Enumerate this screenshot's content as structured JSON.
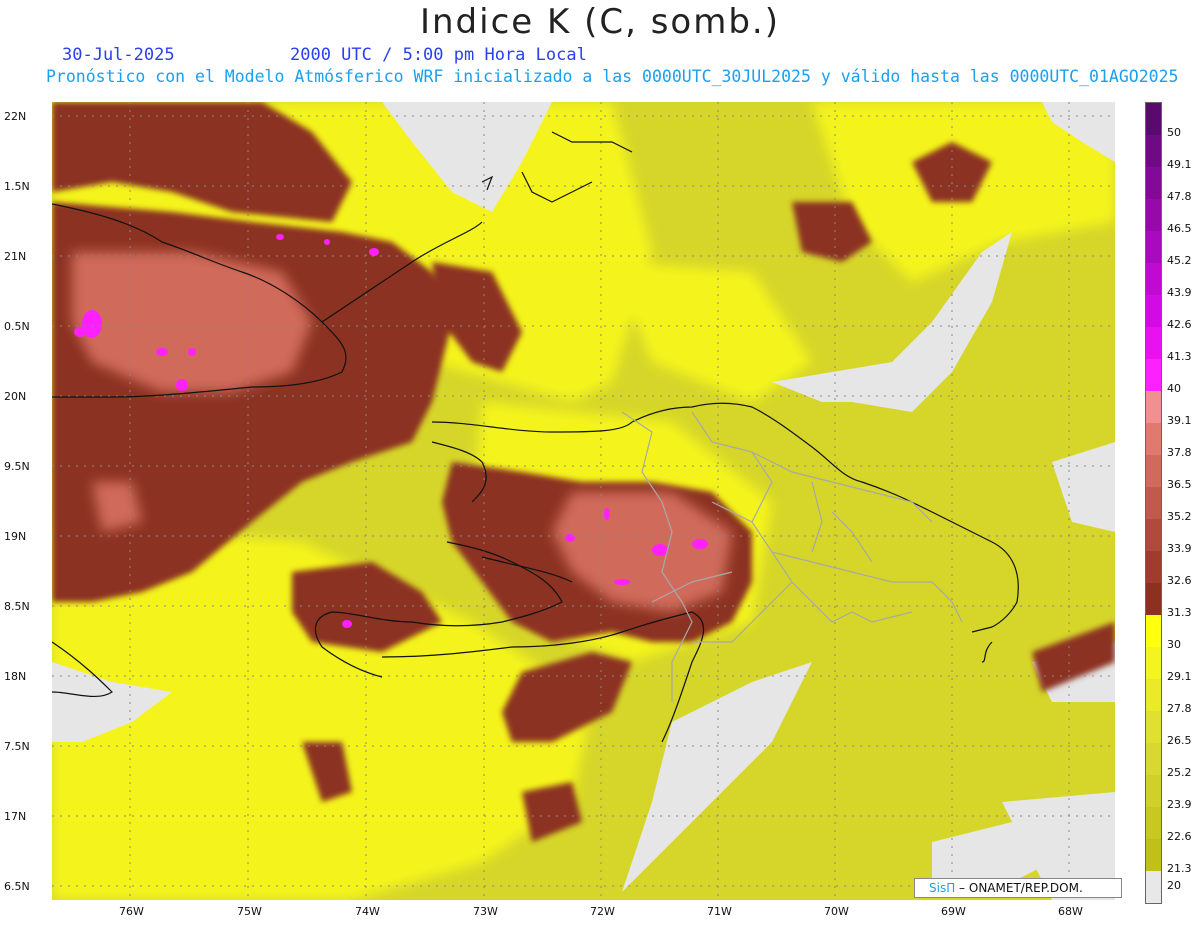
{
  "title": "Indice K (C, somb.)",
  "subtitle": {
    "date": "30-Jul-2025",
    "time": "2000 UTC / 5:00 pm Hora Local",
    "model": "Pronóstico con el Modelo Atmósferico WRF inicializado a las 0000UTC_30JUL2025 y válido hasta las  0000UTC_01AGO2025"
  },
  "lat_labels": [
    "22N",
    "1.5N",
    "21N",
    "0.5N",
    "20N",
    "9.5N",
    "19N",
    "8.5N",
    "18N",
    "7.5N",
    "17N",
    "6.5N"
  ],
  "lon_labels": [
    "76W",
    "75W",
    "74W",
    "73W",
    "72W",
    "71W",
    "70W",
    "69W",
    "68W"
  ],
  "colorbar": {
    "labels": [
      "50",
      "49.1",
      "47.8",
      "46.5",
      "45.2",
      "43.9",
      "42.6",
      "41.3",
      "40",
      "39.1",
      "37.8",
      "36.5",
      "35.2",
      "33.9",
      "32.6",
      "31.3",
      "30",
      "29.1",
      "27.8",
      "26.5",
      "25.2",
      "23.9",
      "22.6",
      "21.3",
      "20"
    ],
    "colors": [
      "#5a0a6e",
      "#6e0a82",
      "#820a96",
      "#960aaa",
      "#aa0abe",
      "#c00ad2",
      "#d40ae6",
      "#ea10f0",
      "#ff20ff",
      "#f09090",
      "#e07a6e",
      "#d06a5a",
      "#c05a4a",
      "#b04a3a",
      "#a03c2c",
      "#8c3020",
      "#ffff10",
      "#f4f420",
      "#eaea28",
      "#e0e030",
      "#d8d830",
      "#d0d028",
      "#c8c820",
      "#c0c018",
      "#e8e8e8"
    ],
    "min_label": "20"
  },
  "credit": {
    "brand": "SisΠ",
    "org": "ONAMET/REP.DOM."
  }
}
